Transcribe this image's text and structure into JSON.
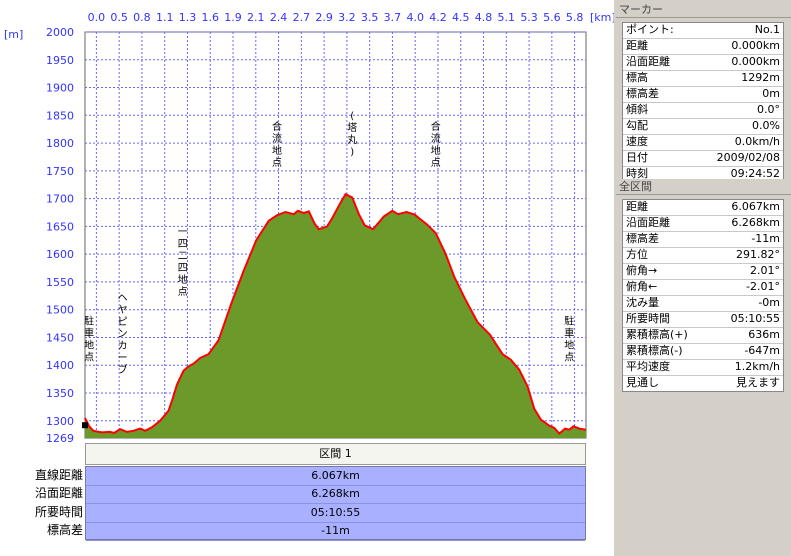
{
  "chart_data": {
    "type": "area",
    "x_unit": "[km]",
    "y_unit": "[m]",
    "xlim": [
      0.0,
      6.0
    ],
    "ylim": [
      1269,
      2000
    ],
    "x_ticks": [
      "0.0",
      "0.5",
      "0.8",
      "1.1",
      "1.3",
      "1.6",
      "1.9",
      "2.1",
      "2.4",
      "2.7",
      "2.9",
      "3.2",
      "3.5",
      "3.7",
      "4.0",
      "4.2",
      "4.5",
      "4.8",
      "5.1",
      "5.3",
      "5.6",
      "5.8"
    ],
    "y_ticks": [
      "2000",
      "1950",
      "1900",
      "1850",
      "1800",
      "1750",
      "1700",
      "1650",
      "1600",
      "1550",
      "1500",
      "1450",
      "1400",
      "1350",
      "1300",
      "1269"
    ],
    "fill_color": "#6b9a2b",
    "line_color": "#ff0000",
    "x": [
      0.0,
      0.05,
      0.1,
      0.2,
      0.3,
      0.35,
      0.42,
      0.5,
      0.58,
      0.66,
      0.72,
      0.8,
      0.9,
      1.0,
      1.05,
      1.1,
      1.18,
      1.24,
      1.3,
      1.38,
      1.48,
      1.6,
      1.75,
      1.9,
      2.05,
      2.2,
      2.3,
      2.4,
      2.5,
      2.55,
      2.62,
      2.68,
      2.75,
      2.8,
      2.9,
      2.96,
      3.05,
      3.12,
      3.2,
      3.28,
      3.35,
      3.45,
      3.58,
      3.68,
      3.75,
      3.85,
      3.95,
      4.0,
      4.1,
      4.2,
      4.32,
      4.42,
      4.55,
      4.7,
      4.85,
      5.0,
      5.1,
      5.2,
      5.3,
      5.38,
      5.46,
      5.5,
      5.55,
      5.62,
      5.68,
      5.75,
      5.8,
      5.85,
      5.92,
      6.0
    ],
    "y": [
      1305,
      1290,
      1282,
      1279,
      1280,
      1278,
      1285,
      1280,
      1282,
      1286,
      1282,
      1288,
      1300,
      1318,
      1340,
      1365,
      1390,
      1398,
      1403,
      1413,
      1420,
      1445,
      1510,
      1570,
      1625,
      1660,
      1670,
      1676,
      1672,
      1678,
      1674,
      1677,
      1655,
      1645,
      1650,
      1665,
      1690,
      1708,
      1702,
      1672,
      1652,
      1645,
      1668,
      1678,
      1672,
      1676,
      1671,
      1665,
      1653,
      1638,
      1600,
      1560,
      1520,
      1478,
      1455,
      1420,
      1410,
      1392,
      1362,
      1322,
      1302,
      1298,
      1292,
      1287,
      1277,
      1286,
      1284,
      1290,
      1286,
      1284
    ],
    "annotations": [
      {
        "text": "駐車地点",
        "x": 0.05,
        "y": 1430
      },
      {
        "text": "ヘヤピンカーブ",
        "x": 0.45,
        "y": 1440
      },
      {
        "text": "一四二四地点",
        "x": 1.17,
        "y": 1570
      },
      {
        "text": "合流地点",
        "x": 2.3,
        "y": 1780
      },
      {
        "text": "(塔丸)",
        "x": 3.2,
        "y": 1800
      },
      {
        "text": "合流地点",
        "x": 4.2,
        "y": 1780
      },
      {
        "text": "駐車地点",
        "x": 5.8,
        "y": 1430
      }
    ]
  },
  "section": {
    "header": "区間 1",
    "rows": [
      {
        "label": "直線距離",
        "value": "6.067km"
      },
      {
        "label": "沿面距離",
        "value": "6.268km"
      },
      {
        "label": "所要時間",
        "value": "05:10:55"
      },
      {
        "label": "標高差",
        "value": "-11m"
      }
    ]
  },
  "marker": {
    "title": "マーカー",
    "rows": [
      {
        "k": "ポイント:",
        "v": "No.1"
      },
      {
        "k": "距離",
        "v": "0.000km"
      },
      {
        "k": "沿面距離",
        "v": "0.000km"
      },
      {
        "k": "標高",
        "v": "1292m"
      },
      {
        "k": "標高差",
        "v": "0m"
      },
      {
        "k": "傾斜",
        "v": "0.0°"
      },
      {
        "k": "勾配",
        "v": "0.0%"
      },
      {
        "k": "速度",
        "v": "0.0km/h"
      },
      {
        "k": "日付",
        "v": "2009/02/08"
      },
      {
        "k": "時刻",
        "v": "09:24:52"
      }
    ]
  },
  "all_sections": {
    "title": "全区間",
    "rows": [
      {
        "k": "距離",
        "v": "6.067km"
      },
      {
        "k": "沿面距離",
        "v": "6.268km"
      },
      {
        "k": "標高差",
        "v": "-11m"
      },
      {
        "k": "方位",
        "v": "291.82°"
      },
      {
        "k": "俯角→",
        "v": "2.01°"
      },
      {
        "k": "俯角←",
        "v": "-2.01°"
      },
      {
        "k": "沈み量",
        "v": "-0m"
      },
      {
        "k": "所要時間",
        "v": "05:10:55"
      },
      {
        "k": "累積標高(+)",
        "v": "636m"
      },
      {
        "k": "累積標高(-)",
        "v": "-647m"
      },
      {
        "k": "平均速度",
        "v": "1.2km/h"
      },
      {
        "k": "見通し",
        "v": "見えます"
      }
    ]
  }
}
